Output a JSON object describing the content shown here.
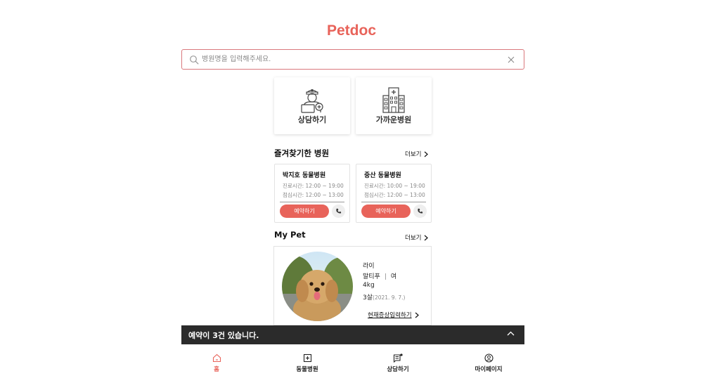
{
  "app": {
    "title": "Petdoc"
  },
  "search": {
    "placeholder": "병원명을 입력해주세요."
  },
  "tiles": [
    {
      "label": "상담하기",
      "icon": "vet-doctor-icon"
    },
    {
      "label": "가까운병원",
      "icon": "hospital-building-icon"
    }
  ],
  "favorites": {
    "title": "즐겨찾기한 병원",
    "more": "더보기",
    "items": [
      {
        "name": "박지호 동물병원",
        "hours": "진료시간: 12:00 ~ 19:00",
        "lunch": "점심시간: 12:00 ~ 13:00",
        "book_label": "예약하기"
      },
      {
        "name": "중산 동물병원",
        "hours": "진료시간: 10:00 ~ 19:00",
        "lunch": "점심시간: 12:00 ~ 13:00",
        "book_label": "예약하기"
      }
    ]
  },
  "mypet": {
    "title": "My Pet",
    "more": "더보기",
    "name": "라이",
    "breed": "말티푸",
    "sex": "여",
    "weight": "4kg",
    "age": "3살",
    "birth": "(2021. 9. 7.)",
    "symptom_link": "현재증상입력하기"
  },
  "banner": {
    "text": "예약이 3건 있습니다."
  },
  "tabs": [
    {
      "label": "홈",
      "icon": "home-icon",
      "active": true
    },
    {
      "label": "동물병원",
      "icon": "plus-square-icon",
      "active": false
    },
    {
      "label": "상담하기",
      "icon": "chat-list-icon",
      "active": false
    },
    {
      "label": "마이페이지",
      "icon": "user-circle-icon",
      "active": false
    }
  ],
  "colors": {
    "accent": "#e8635a",
    "banner": "#2b2b2b",
    "border": "#d9787c"
  }
}
